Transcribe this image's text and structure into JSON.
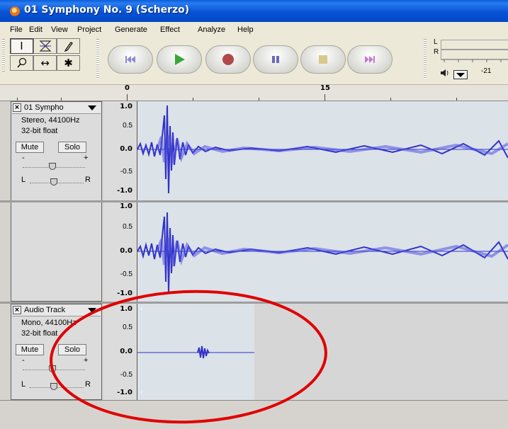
{
  "window": {
    "title": "01 Symphony No. 9 (Scherzo)"
  },
  "menu": [
    "File",
    "Edit",
    "View",
    "Project",
    "Generate",
    "Effect",
    "Analyze",
    "Help"
  ],
  "tools": [
    "selection-tool",
    "envelope-tool",
    "draw-tool",
    "zoom-tool",
    "timeshift-tool",
    "multi-tool"
  ],
  "transport": [
    "skip-to-start",
    "play",
    "record",
    "pause",
    "stop",
    "skip-to-end"
  ],
  "meter": {
    "left_label": "L",
    "right_label": "R",
    "level_value": "-21"
  },
  "ruler": {
    "labels": [
      "0",
      "15"
    ]
  },
  "colors": {
    "waveform": "#3232c8",
    "record": "#b04a4a",
    "play": "#3aa63a"
  },
  "tracks": [
    {
      "name": "01 Sympho",
      "format": "Stereo, 44100Hz",
      "bits": "32-bit float",
      "mute_label": "Mute",
      "solo_label": "Solo",
      "gain_minus": "-",
      "gain_plus": "+",
      "pan_left": "L",
      "pan_right": "R",
      "channels": [
        {
          "scale": [
            "1.0",
            "0.5",
            "0.0",
            "-0.5",
            "-1.0"
          ]
        },
        {
          "scale": [
            "1.0",
            "0.5",
            "0.0",
            "-0.5",
            "-1.0"
          ]
        }
      ]
    },
    {
      "name": "Audio Track",
      "format": "Mono, 44100Hz",
      "bits": "32-bit float",
      "mute_label": "Mute",
      "solo_label": "Solo",
      "gain_minus": "-",
      "gain_plus": "+",
      "pan_left": "L",
      "pan_right": "R",
      "channels": [
        {
          "scale": [
            "1.0",
            "0.5",
            "0.0",
            "-0.5",
            "-1.0"
          ]
        }
      ]
    }
  ],
  "annotation": {
    "shape": "ellipse",
    "color": "#e00000"
  }
}
